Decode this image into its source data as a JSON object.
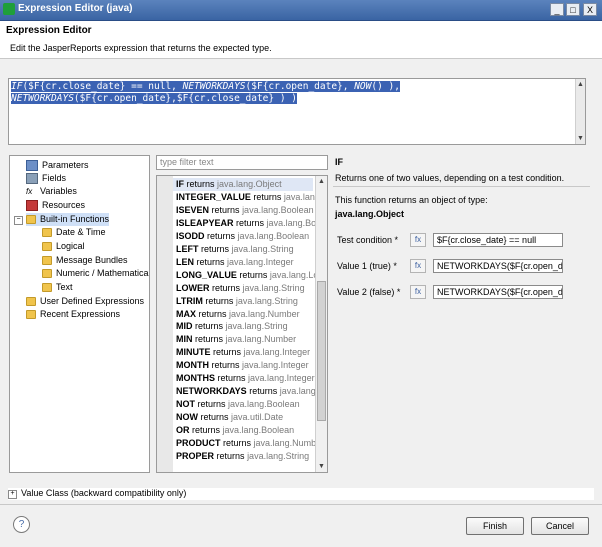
{
  "window": {
    "title": "Expression Editor (java)",
    "min_label": "_",
    "max_label": "□",
    "close_label": "X"
  },
  "header": {
    "title": "Expression Editor",
    "subtitle": "Edit the JasperReports expression that returns the expected type."
  },
  "editor": {
    "line1": [
      {
        "text": "IF",
        "italic": true
      },
      {
        "text": "($F{cr.close_date} == null, ",
        "italic": false
      },
      {
        "text": "NETWORKDAYS",
        "italic": true
      },
      {
        "text": "($F{cr.open_date}, ",
        "italic": false
      },
      {
        "text": "NOW",
        "italic": true
      },
      {
        "text": "() ),",
        "italic": false
      }
    ],
    "line2": [
      {
        "text": "NETWORKDAYS",
        "italic": true
      },
      {
        "text": "($F{cr.open_date},$F{cr.close_date} ) )",
        "italic": false
      }
    ]
  },
  "tree": {
    "items": [
      {
        "label": "Parameters",
        "icon": "parameters-icon"
      },
      {
        "label": "Fields",
        "icon": "fields-icon"
      },
      {
        "label": "Variables",
        "icon": "variables-icon"
      },
      {
        "label": "Resources",
        "icon": "resources-icon"
      },
      {
        "label": "Built-in Functions",
        "icon": "folder-icon"
      },
      {
        "label": "Date & Time",
        "icon": "folder-icon"
      },
      {
        "label": "Logical",
        "icon": "folder-icon"
      },
      {
        "label": "Message Bundles",
        "icon": "folder-icon"
      },
      {
        "label": "Numeric / Mathematical",
        "icon": "folder-icon"
      },
      {
        "label": "Text",
        "icon": "folder-icon"
      },
      {
        "label": "User Defined Expressions",
        "icon": "folder-icon"
      },
      {
        "label": "Recent Expressions",
        "icon": "folder-icon"
      }
    ]
  },
  "filter": {
    "placeholder": "type filter text"
  },
  "functions": [
    {
      "name": "IF",
      "returns": "returns",
      "type": "java.lang.Object"
    },
    {
      "name": "INTEGER_VALUE",
      "returns": "returns",
      "type": "java.lang.Integer"
    },
    {
      "name": "ISEVEN",
      "returns": "returns",
      "type": "java.lang.Boolean"
    },
    {
      "name": "ISLEAPYEAR",
      "returns": "returns",
      "type": "java.lang.Boolean"
    },
    {
      "name": "ISODD",
      "returns": "returns",
      "type": "java.lang.Boolean"
    },
    {
      "name": "LEFT",
      "returns": "returns",
      "type": "java.lang.String"
    },
    {
      "name": "LEN",
      "returns": "returns",
      "type": "java.lang.Integer"
    },
    {
      "name": "LONG_VALUE",
      "returns": "returns",
      "type": "java.lang.Long"
    },
    {
      "name": "LOWER",
      "returns": "returns",
      "type": "java.lang.String"
    },
    {
      "name": "LTRIM",
      "returns": "returns",
      "type": "java.lang.String"
    },
    {
      "name": "MAX",
      "returns": "returns",
      "type": "java.lang.Number"
    },
    {
      "name": "MID",
      "returns": "returns",
      "type": "java.lang.String"
    },
    {
      "name": "MIN",
      "returns": "returns",
      "type": "java.lang.Number"
    },
    {
      "name": "MINUTE",
      "returns": "returns",
      "type": "java.lang.Integer"
    },
    {
      "name": "MONTH",
      "returns": "returns",
      "type": "java.lang.Integer"
    },
    {
      "name": "MONTHS",
      "returns": "returns",
      "type": "java.lang.Integer"
    },
    {
      "name": "NETWORKDAYS",
      "returns": "returns",
      "type": "java.lang.Integer"
    },
    {
      "name": "NOT",
      "returns": "returns",
      "type": "java.lang.Boolean"
    },
    {
      "name": "NOW",
      "returns": "returns",
      "type": "java.util.Date"
    },
    {
      "name": "OR",
      "returns": "returns",
      "type": "java.lang.Boolean"
    },
    {
      "name": "PRODUCT",
      "returns": "returns",
      "type": "java.lang.Number"
    },
    {
      "name": "PROPER",
      "returns": "returns",
      "type": "java.lang.String"
    }
  ],
  "detail": {
    "name": "IF",
    "description": "Returns one of two values, depending on a test condition.",
    "returns_label": "This function returns an object of type:",
    "return_type": "java.lang.Object",
    "params": [
      {
        "label": "Test condition *",
        "value": "$F{cr.close_date} == null",
        "button": "fx"
      },
      {
        "label": "Value 1 (true) *",
        "value": "NETWORKDAYS($F{cr.open_date}",
        "button": "fx"
      },
      {
        "label": "Value 2 (false) *",
        "value": "NETWORKDAYS($F{cr.open_date}",
        "button": "fx"
      }
    ]
  },
  "value_class": {
    "label": "Value Class (backward compatibility only)",
    "toggle": "+"
  },
  "footer": {
    "help": "?",
    "finish": "Finish",
    "cancel": "Cancel"
  },
  "colors": {
    "title_bar": "#3a64a3",
    "selection": "#3b62b3"
  }
}
